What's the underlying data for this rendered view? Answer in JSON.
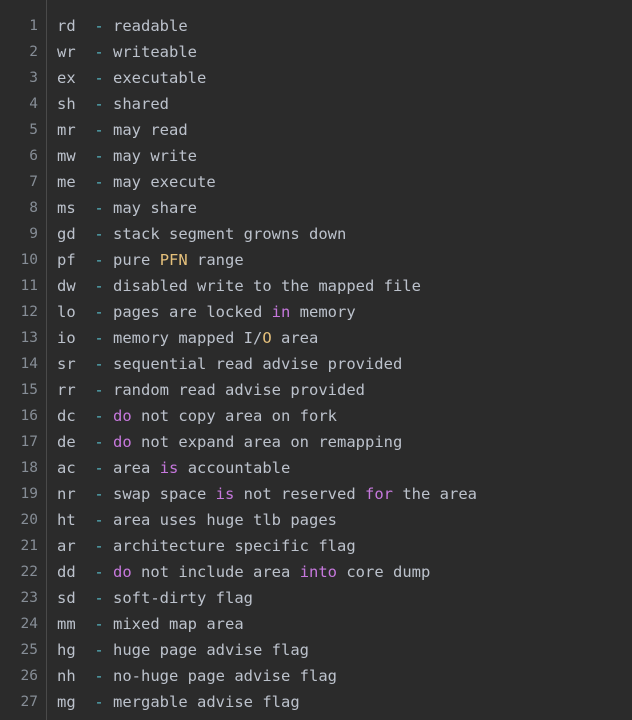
{
  "editor": {
    "theme_name": "one-dark",
    "background_color": "#2b2b2b",
    "gutter_divider_color": "#4a4a4a",
    "line_number_color": "#868d96",
    "colors": {
      "plain": "#bcc2cc",
      "dash": "#56b6c2",
      "keyword": "#c678dd",
      "constant": "#e5c07b"
    },
    "first_line_number": 1,
    "last_line_number": 27,
    "total_lines": 27
  },
  "lines": [
    {
      "number": "1",
      "text": "rd  - readable",
      "tokens": [
        {
          "t": "rd",
          "k": "flag"
        },
        {
          "t": "  ",
          "k": "plain"
        },
        {
          "t": "-",
          "k": "dash"
        },
        {
          "t": " readable",
          "k": "plain"
        }
      ]
    },
    {
      "number": "2",
      "text": "wr  - writeable",
      "tokens": [
        {
          "t": "wr",
          "k": "flag"
        },
        {
          "t": "  ",
          "k": "plain"
        },
        {
          "t": "-",
          "k": "dash"
        },
        {
          "t": " writeable",
          "k": "plain"
        }
      ]
    },
    {
      "number": "3",
      "text": "ex  - executable",
      "tokens": [
        {
          "t": "ex",
          "k": "flag"
        },
        {
          "t": "  ",
          "k": "plain"
        },
        {
          "t": "-",
          "k": "dash"
        },
        {
          "t": " executable",
          "k": "plain"
        }
      ]
    },
    {
      "number": "4",
      "text": "sh  - shared",
      "tokens": [
        {
          "t": "sh",
          "k": "flag"
        },
        {
          "t": "  ",
          "k": "plain"
        },
        {
          "t": "-",
          "k": "dash"
        },
        {
          "t": " shared",
          "k": "plain"
        }
      ]
    },
    {
      "number": "5",
      "text": "mr  - may read",
      "tokens": [
        {
          "t": "mr",
          "k": "flag"
        },
        {
          "t": "  ",
          "k": "plain"
        },
        {
          "t": "-",
          "k": "dash"
        },
        {
          "t": " may read",
          "k": "plain"
        }
      ]
    },
    {
      "number": "6",
      "text": "mw  - may write",
      "tokens": [
        {
          "t": "mw",
          "k": "flag"
        },
        {
          "t": "  ",
          "k": "plain"
        },
        {
          "t": "-",
          "k": "dash"
        },
        {
          "t": " may write",
          "k": "plain"
        }
      ]
    },
    {
      "number": "7",
      "text": "me  - may execute",
      "tokens": [
        {
          "t": "me",
          "k": "flag"
        },
        {
          "t": "  ",
          "k": "plain"
        },
        {
          "t": "-",
          "k": "dash"
        },
        {
          "t": " may execute",
          "k": "plain"
        }
      ]
    },
    {
      "number": "8",
      "text": "ms  - may share",
      "tokens": [
        {
          "t": "ms",
          "k": "flag"
        },
        {
          "t": "  ",
          "k": "plain"
        },
        {
          "t": "-",
          "k": "dash"
        },
        {
          "t": " may share",
          "k": "plain"
        }
      ]
    },
    {
      "number": "9",
      "text": "gd  - stack segment growns down",
      "tokens": [
        {
          "t": "gd",
          "k": "flag"
        },
        {
          "t": "  ",
          "k": "plain"
        },
        {
          "t": "-",
          "k": "dash"
        },
        {
          "t": " stack segment growns down",
          "k": "plain"
        }
      ]
    },
    {
      "number": "10",
      "text": "pf  - pure PFN range",
      "tokens": [
        {
          "t": "pf",
          "k": "flag"
        },
        {
          "t": "  ",
          "k": "plain"
        },
        {
          "t": "-",
          "k": "dash"
        },
        {
          "t": " pure ",
          "k": "plain"
        },
        {
          "t": "PFN",
          "k": "const"
        },
        {
          "t": " range",
          "k": "plain"
        }
      ]
    },
    {
      "number": "11",
      "text": "dw  - disabled write to the mapped file",
      "tokens": [
        {
          "t": "dw",
          "k": "flag"
        },
        {
          "t": "  ",
          "k": "plain"
        },
        {
          "t": "-",
          "k": "dash"
        },
        {
          "t": " disabled write to the mapped file",
          "k": "plain"
        }
      ]
    },
    {
      "number": "12",
      "text": "lo  - pages are locked in memory",
      "tokens": [
        {
          "t": "lo",
          "k": "flag"
        },
        {
          "t": "  ",
          "k": "plain"
        },
        {
          "t": "-",
          "k": "dash"
        },
        {
          "t": " pages are locked ",
          "k": "plain"
        },
        {
          "t": "in",
          "k": "keyword"
        },
        {
          "t": " memory",
          "k": "plain"
        }
      ]
    },
    {
      "number": "13",
      "text": "io  - memory mapped I/O area",
      "tokens": [
        {
          "t": "io",
          "k": "flag"
        },
        {
          "t": "  ",
          "k": "plain"
        },
        {
          "t": "-",
          "k": "dash"
        },
        {
          "t": " memory mapped I/",
          "k": "plain"
        },
        {
          "t": "O",
          "k": "const"
        },
        {
          "t": " area",
          "k": "plain"
        }
      ]
    },
    {
      "number": "14",
      "text": "sr  - sequential read advise provided",
      "tokens": [
        {
          "t": "sr",
          "k": "flag"
        },
        {
          "t": "  ",
          "k": "plain"
        },
        {
          "t": "-",
          "k": "dash"
        },
        {
          "t": " sequential read advise provided",
          "k": "plain"
        }
      ]
    },
    {
      "number": "15",
      "text": "rr  - random read advise provided",
      "tokens": [
        {
          "t": "rr",
          "k": "flag"
        },
        {
          "t": "  ",
          "k": "plain"
        },
        {
          "t": "-",
          "k": "dash"
        },
        {
          "t": " random read advise provided",
          "k": "plain"
        }
      ]
    },
    {
      "number": "16",
      "text": "dc  - do not copy area on fork",
      "tokens": [
        {
          "t": "dc",
          "k": "flag"
        },
        {
          "t": "  ",
          "k": "plain"
        },
        {
          "t": "-",
          "k": "dash"
        },
        {
          "t": " ",
          "k": "plain"
        },
        {
          "t": "do",
          "k": "keyword"
        },
        {
          "t": " not copy area on fork",
          "k": "plain"
        }
      ]
    },
    {
      "number": "17",
      "text": "de  - do not expand area on remapping",
      "tokens": [
        {
          "t": "de",
          "k": "flag"
        },
        {
          "t": "  ",
          "k": "plain"
        },
        {
          "t": "-",
          "k": "dash"
        },
        {
          "t": " ",
          "k": "plain"
        },
        {
          "t": "do",
          "k": "keyword"
        },
        {
          "t": " not expand area on remapping",
          "k": "plain"
        }
      ]
    },
    {
      "number": "18",
      "text": "ac  - area is accountable",
      "tokens": [
        {
          "t": "ac",
          "k": "flag"
        },
        {
          "t": "  ",
          "k": "plain"
        },
        {
          "t": "-",
          "k": "dash"
        },
        {
          "t": " area ",
          "k": "plain"
        },
        {
          "t": "is",
          "k": "keyword"
        },
        {
          "t": " accountable",
          "k": "plain"
        }
      ]
    },
    {
      "number": "19",
      "text": "nr  - swap space is not reserved for the area",
      "tokens": [
        {
          "t": "nr",
          "k": "flag"
        },
        {
          "t": "  ",
          "k": "plain"
        },
        {
          "t": "-",
          "k": "dash"
        },
        {
          "t": " swap space ",
          "k": "plain"
        },
        {
          "t": "is",
          "k": "keyword"
        },
        {
          "t": " not reserved ",
          "k": "plain"
        },
        {
          "t": "for",
          "k": "keyword"
        },
        {
          "t": " the area",
          "k": "plain"
        }
      ]
    },
    {
      "number": "20",
      "text": "ht  - area uses huge tlb pages",
      "tokens": [
        {
          "t": "ht",
          "k": "flag"
        },
        {
          "t": "  ",
          "k": "plain"
        },
        {
          "t": "-",
          "k": "dash"
        },
        {
          "t": " area uses huge tlb pages",
          "k": "plain"
        }
      ]
    },
    {
      "number": "21",
      "text": "ar  - architecture specific flag",
      "tokens": [
        {
          "t": "ar",
          "k": "flag"
        },
        {
          "t": "  ",
          "k": "plain"
        },
        {
          "t": "-",
          "k": "dash"
        },
        {
          "t": " architecture specific flag",
          "k": "plain"
        }
      ]
    },
    {
      "number": "22",
      "text": "dd  - do not include area into core dump",
      "tokens": [
        {
          "t": "dd",
          "k": "flag"
        },
        {
          "t": "  ",
          "k": "plain"
        },
        {
          "t": "-",
          "k": "dash"
        },
        {
          "t": " ",
          "k": "plain"
        },
        {
          "t": "do",
          "k": "keyword"
        },
        {
          "t": " not include area ",
          "k": "plain"
        },
        {
          "t": "into",
          "k": "keyword"
        },
        {
          "t": " core dump",
          "k": "plain"
        }
      ]
    },
    {
      "number": "23",
      "text": "sd  - soft-dirty flag",
      "tokens": [
        {
          "t": "sd",
          "k": "flag"
        },
        {
          "t": "  ",
          "k": "plain"
        },
        {
          "t": "-",
          "k": "dash"
        },
        {
          "t": " soft-dirty flag",
          "k": "plain"
        }
      ]
    },
    {
      "number": "24",
      "text": "mm  - mixed map area",
      "tokens": [
        {
          "t": "mm",
          "k": "flag"
        },
        {
          "t": "  ",
          "k": "plain"
        },
        {
          "t": "-",
          "k": "dash"
        },
        {
          "t": " mixed map area",
          "k": "plain"
        }
      ]
    },
    {
      "number": "25",
      "text": "hg  - huge page advise flag",
      "tokens": [
        {
          "t": "hg",
          "k": "flag"
        },
        {
          "t": "  ",
          "k": "plain"
        },
        {
          "t": "-",
          "k": "dash"
        },
        {
          "t": " huge page advise flag",
          "k": "plain"
        }
      ]
    },
    {
      "number": "26",
      "text": "nh  - no-huge page advise flag",
      "tokens": [
        {
          "t": "nh",
          "k": "flag"
        },
        {
          "t": "  ",
          "k": "plain"
        },
        {
          "t": "-",
          "k": "dash"
        },
        {
          "t": " no-huge page advise flag",
          "k": "plain"
        }
      ]
    },
    {
      "number": "27",
      "text": "mg  - mergable advise flag",
      "tokens": [
        {
          "t": "mg",
          "k": "flag"
        },
        {
          "t": "  ",
          "k": "plain"
        },
        {
          "t": "-",
          "k": "dash"
        },
        {
          "t": " mergable advise flag",
          "k": "plain"
        }
      ]
    }
  ]
}
